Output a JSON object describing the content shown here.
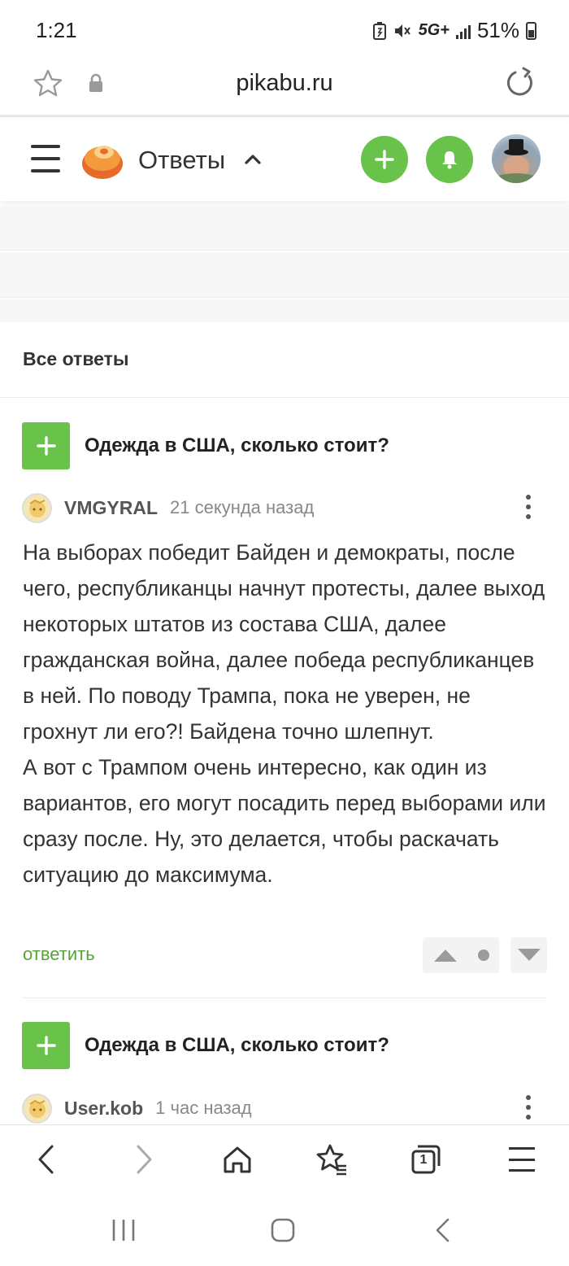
{
  "status": {
    "time": "1:21",
    "network": "5G+",
    "battery": "51%"
  },
  "browser": {
    "url": "pikabu.ru",
    "tab_count": "1"
  },
  "header": {
    "section_title": "Ответы"
  },
  "feed": {
    "heading": "Все ответы",
    "items": [
      {
        "story_title": "Одежда в США, сколько стоит?",
        "author": "VMGYRAL",
        "time": "21 секунда назад",
        "text_paragraphs": [
          "На выборах победит Байден и демократы, после чего, республиканцы начнут протесты, далее выход некоторых штатов из состава США, далее гражданская война, далее победа республиканцев в ней. По поводу Трампа, пока не уверен, не грохнут ли его?! Байдена точно шлепнут.",
          "А вот с Трампом очень интересно, как один из вариантов, его могут посадить перед выборами или сразу после. Ну, это делается, чтобы раскачать ситуацию до максимума."
        ],
        "reply_label": "ответить"
      },
      {
        "story_title": "Одежда в США, сколько стоит?",
        "author": "User.kob",
        "time": "1 час назад"
      }
    ]
  },
  "colors": {
    "accent_green": "#69c24a",
    "link_green": "#57a33a"
  }
}
